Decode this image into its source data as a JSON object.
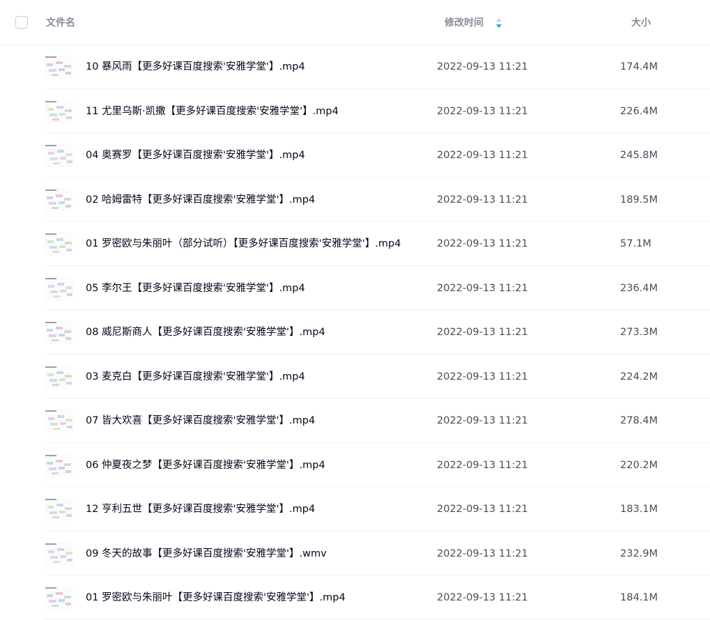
{
  "header": {
    "select_all": false,
    "name_label": "文件名",
    "time_label": "修改时间",
    "size_label": "大小",
    "sort_icon": "sort-arrows-icon"
  },
  "colors": {
    "header_text": "#878c9c",
    "row_text": "#03081a",
    "meta_text": "#454d5a",
    "sort_active": "#06a7ff"
  },
  "files": [
    {
      "name": "10 暴风雨【更多好课百度搜索'安雅学堂'】.mp4",
      "time": "2022-09-13 11:21",
      "size": "174.4M"
    },
    {
      "name": "11 尤里乌斯·凯撒【更多好课百度搜索'安雅学堂'】.mp4",
      "time": "2022-09-13 11:21",
      "size": "226.4M"
    },
    {
      "name": "04 奥赛罗【更多好课百度搜索'安雅学堂'】.mp4",
      "time": "2022-09-13 11:21",
      "size": "245.8M"
    },
    {
      "name": "02 哈姆雷特【更多好课百度搜索'安雅学堂'】.mp4",
      "time": "2022-09-13 11:21",
      "size": "189.5M"
    },
    {
      "name": "01 罗密欧与朱丽叶（部分试听）【更多好课百度搜索'安雅学堂'】.mp4",
      "time": "2022-09-13 11:21",
      "size": "57.1M"
    },
    {
      "name": "05 李尔王【更多好课百度搜索'安雅学堂'】.mp4",
      "time": "2022-09-13 11:21",
      "size": "236.4M"
    },
    {
      "name": "08 威尼斯商人【更多好课百度搜索'安雅学堂'】.mp4",
      "time": "2022-09-13 11:21",
      "size": "273.3M"
    },
    {
      "name": "03 麦克白【更多好课百度搜索'安雅学堂'】.mp4",
      "time": "2022-09-13 11:21",
      "size": "224.2M"
    },
    {
      "name": "07 皆大欢喜【更多好课百度搜索'安雅学堂'】.mp4",
      "time": "2022-09-13 11:21",
      "size": "278.4M"
    },
    {
      "name": "06 仲夏夜之梦【更多好课百度搜索'安雅学堂'】.mp4",
      "time": "2022-09-13 11:21",
      "size": "220.2M"
    },
    {
      "name": "12 亨利五世【更多好课百度搜索'安雅学堂'】.mp4",
      "time": "2022-09-13 11:21",
      "size": "183.1M"
    },
    {
      "name": "09 冬天的故事【更多好课百度搜索'安雅学堂'】.wmv",
      "time": "2022-09-13 11:21",
      "size": "232.9M"
    },
    {
      "name": "01 罗密欧与朱丽叶【更多好课百度搜索'安雅学堂'】.mp4",
      "time": "2022-09-13 11:21",
      "size": "184.1M"
    }
  ]
}
